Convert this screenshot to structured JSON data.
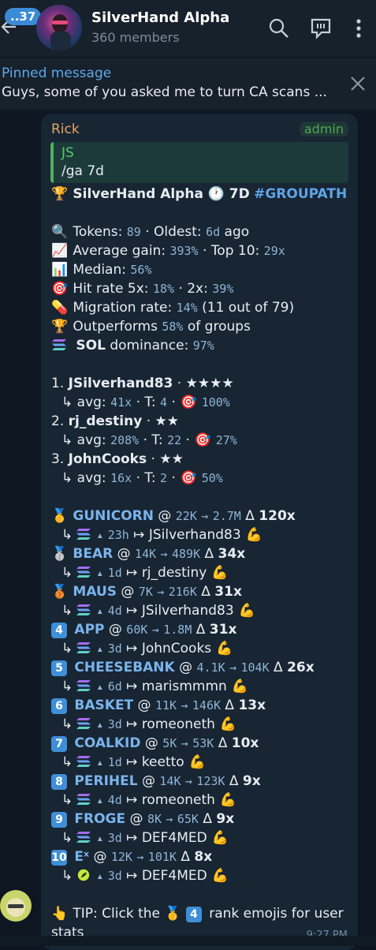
{
  "header": {
    "unread_badge": "..37",
    "title": "SilverHand Alpha",
    "subtitle": "360 members"
  },
  "pinned": {
    "label": "Pinned message",
    "text": "Guys, some of you asked me to turn CA scans ..."
  },
  "message": {
    "sender": "Rick",
    "role": "admin",
    "quote_title": "JS",
    "quote_text": "/ga 7d",
    "headline": {
      "group": "SilverHand Alpha",
      "period": "7D",
      "tag": "#GROUPATH"
    },
    "stats": {
      "tokens": "89",
      "oldest": "6d",
      "avg_gain": "393%",
      "top10": "29x",
      "median": "56%",
      "hit5x": "18%",
      "hit2x": "39%",
      "migration": "14%",
      "migration_detail": "(11 out of 79)",
      "outperforms": "58%",
      "sol_dominance": "97%"
    },
    "leaders": [
      {
        "rank": "1.",
        "name": "JSilverhand83",
        "stars": "★★★★",
        "avg": "41x",
        "t": "4",
        "rate": "100%"
      },
      {
        "rank": "2.",
        "name": "rj_destiny",
        "stars": "★★",
        "avg": "208%",
        "t": "22",
        "rate": "27%"
      },
      {
        "rank": "3.",
        "name": "JohnCooks",
        "stars": "★★",
        "avg": "16x",
        "t": "2",
        "rate": "50%"
      }
    ],
    "tokens": [
      {
        "rank": "🥇",
        "name": "GUNICORN",
        "from": "22K",
        "to": "2.7M",
        "delta": "120x",
        "time": "23h",
        "caller": "JSilverhand83"
      },
      {
        "rank": "🥈",
        "name": "BEAR",
        "from": "14K",
        "to": "489K",
        "delta": "34x",
        "time": "1d",
        "caller": "rj_destiny"
      },
      {
        "rank": "🥉",
        "name": "MAUS",
        "from": "7K",
        "to": "216K",
        "delta": "31x",
        "time": "4d",
        "caller": "JSilverhand83"
      },
      {
        "rank": "4",
        "name": "APP",
        "from": "60K",
        "to": "1.8M",
        "delta": "31x",
        "time": "3d",
        "caller": "JohnCooks"
      },
      {
        "rank": "5",
        "name": "CHEESEBANK",
        "from": "4.1K",
        "to": "104K",
        "delta": "26x",
        "time": "6d",
        "caller": "marismmmn"
      },
      {
        "rank": "6",
        "name": "BASKET",
        "from": "11K",
        "to": "146K",
        "delta": "13x",
        "time": "3d",
        "caller": "romeoneth"
      },
      {
        "rank": "7",
        "name": "COALKID",
        "from": "5K",
        "to": "53K",
        "delta": "10x",
        "time": "1d",
        "caller": "keetto"
      },
      {
        "rank": "8",
        "name": "PERIHEL",
        "from": "14K",
        "to": "123K",
        "delta": "9x",
        "time": "4d",
        "caller": "romeoneth"
      },
      {
        "rank": "9",
        "name": "FROGE",
        "from": "8K",
        "to": "65K",
        "delta": "9x",
        "time": "3d",
        "caller": "DEF4MED"
      },
      {
        "rank": "10",
        "name": "Eˣ",
        "from": "12K",
        "to": "101K",
        "delta": "8x",
        "time": "3d",
        "caller": "DEF4MED"
      }
    ],
    "tip": "TIP: Click the",
    "tip_end": "rank emojis for user",
    "tip_cont": "stats",
    "time": "9:27 PM"
  },
  "labels": {
    "tokens": "Tokens:",
    "oldest": "· Oldest:",
    "ago": "ago",
    "avg_gain": "Average gain:",
    "top10": "· Top 10:",
    "median": "Median:",
    "hit_rate": "Hit rate 5x:",
    "hit2x": "· 2x:",
    "migration": "Migration rate:",
    "outperforms": "Outperforms",
    "of_groups": "of groups",
    "sol": "SOL",
    "dominance": "dominance:",
    "avg": "↳ avg:",
    "t": "· T:"
  },
  "colors": {
    "accent": "#5ea4e8",
    "admin": "#4fa84f",
    "sender": "#e8a66a",
    "bubble": "#182533"
  }
}
